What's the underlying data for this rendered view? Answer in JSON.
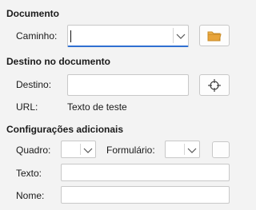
{
  "document_section": {
    "title": "Documento",
    "path_label": "Caminho:",
    "path_value": ""
  },
  "target_section": {
    "title": "Destino no documento",
    "target_label": "Destino:",
    "target_value": "",
    "url_label": "URL:",
    "url_value": "Texto de teste"
  },
  "additional_section": {
    "title": "Configurações adicionais",
    "frame_label": "Quadro:",
    "frame_value": "",
    "form_label": "Formulário:",
    "form_value": "",
    "text_label": "Texto:",
    "text_value": "",
    "name_label": "Nome:",
    "name_value": ""
  },
  "icons": {
    "open_file": "folder-icon",
    "target_picker": "crosshair-icon",
    "dropdown": "chevron-down-icon"
  },
  "colors": {
    "focus_accent": "#2f6fd1",
    "folder": "#e8a43a"
  }
}
